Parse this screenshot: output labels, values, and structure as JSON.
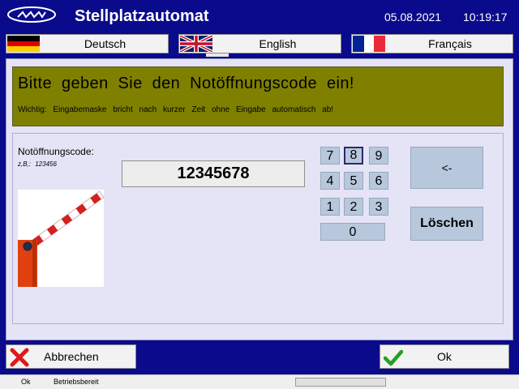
{
  "header": {
    "title": "Stellplatzautomat",
    "date": "05.08.2021",
    "time": "10:19:17"
  },
  "languages": [
    {
      "label": "Deutsch",
      "flag": "german-flag-icon"
    },
    {
      "label": "English",
      "flag": "uk-flag-icon",
      "active": true
    },
    {
      "label": "Français",
      "flag": "french-flag-icon"
    }
  ],
  "banner": {
    "title": "Bitte geben Sie den Notöffnungscode ein!",
    "note": "Wichtig: Eingabemaske bricht nach kurzer Zeit ohne Eingabe automatisch ab!"
  },
  "form": {
    "label": "Notöffnungscode:",
    "example": "z,B,:  123456",
    "value": "12345678"
  },
  "keypad": {
    "keys": [
      "7",
      "8",
      "9",
      "4",
      "5",
      "6",
      "1",
      "2",
      "3"
    ],
    "zero": "0",
    "selected_key": "8",
    "back_label": "<-",
    "clear_label": "Löschen"
  },
  "actions": {
    "cancel_label": "Abbrechen",
    "ok_label": "Ok"
  },
  "status": {
    "state": "Ok",
    "text": "Betriebsbereit"
  },
  "colors": {
    "background": "#0a0a8c",
    "banner": "#808000",
    "panel": "#e4e4f6",
    "key": "#b8c8dc"
  }
}
